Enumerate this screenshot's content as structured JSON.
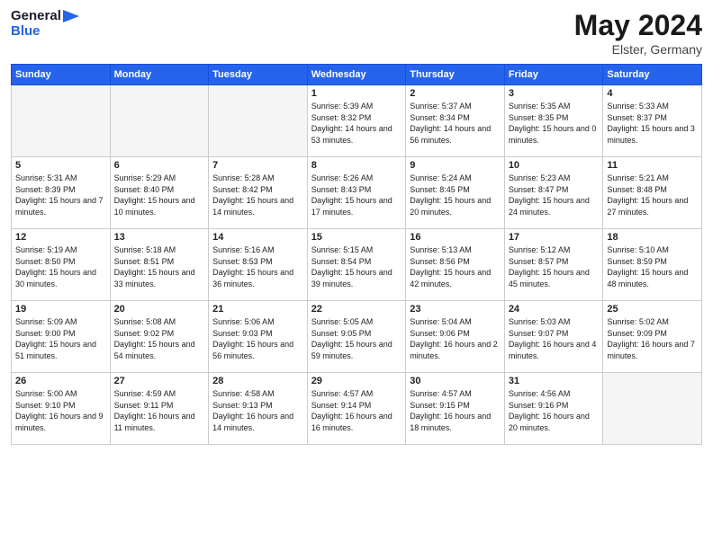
{
  "header": {
    "logo_line1": "General",
    "logo_line2": "Blue",
    "month": "May 2024",
    "location": "Elster, Germany"
  },
  "weekdays": [
    "Sunday",
    "Monday",
    "Tuesday",
    "Wednesday",
    "Thursday",
    "Friday",
    "Saturday"
  ],
  "weeks": [
    [
      {
        "day": "",
        "text": "",
        "empty": true
      },
      {
        "day": "",
        "text": "",
        "empty": true
      },
      {
        "day": "",
        "text": "",
        "empty": true
      },
      {
        "day": "1",
        "text": "Sunrise: 5:39 AM\nSunset: 8:32 PM\nDaylight: 14 hours and 53 minutes."
      },
      {
        "day": "2",
        "text": "Sunrise: 5:37 AM\nSunset: 8:34 PM\nDaylight: 14 hours and 56 minutes."
      },
      {
        "day": "3",
        "text": "Sunrise: 5:35 AM\nSunset: 8:35 PM\nDaylight: 15 hours and 0 minutes."
      },
      {
        "day": "4",
        "text": "Sunrise: 5:33 AM\nSunset: 8:37 PM\nDaylight: 15 hours and 3 minutes."
      }
    ],
    [
      {
        "day": "5",
        "text": "Sunrise: 5:31 AM\nSunset: 8:39 PM\nDaylight: 15 hours and 7 minutes."
      },
      {
        "day": "6",
        "text": "Sunrise: 5:29 AM\nSunset: 8:40 PM\nDaylight: 15 hours and 10 minutes."
      },
      {
        "day": "7",
        "text": "Sunrise: 5:28 AM\nSunset: 8:42 PM\nDaylight: 15 hours and 14 minutes."
      },
      {
        "day": "8",
        "text": "Sunrise: 5:26 AM\nSunset: 8:43 PM\nDaylight: 15 hours and 17 minutes."
      },
      {
        "day": "9",
        "text": "Sunrise: 5:24 AM\nSunset: 8:45 PM\nDaylight: 15 hours and 20 minutes."
      },
      {
        "day": "10",
        "text": "Sunrise: 5:23 AM\nSunset: 8:47 PM\nDaylight: 15 hours and 24 minutes."
      },
      {
        "day": "11",
        "text": "Sunrise: 5:21 AM\nSunset: 8:48 PM\nDaylight: 15 hours and 27 minutes."
      }
    ],
    [
      {
        "day": "12",
        "text": "Sunrise: 5:19 AM\nSunset: 8:50 PM\nDaylight: 15 hours and 30 minutes."
      },
      {
        "day": "13",
        "text": "Sunrise: 5:18 AM\nSunset: 8:51 PM\nDaylight: 15 hours and 33 minutes."
      },
      {
        "day": "14",
        "text": "Sunrise: 5:16 AM\nSunset: 8:53 PM\nDaylight: 15 hours and 36 minutes."
      },
      {
        "day": "15",
        "text": "Sunrise: 5:15 AM\nSunset: 8:54 PM\nDaylight: 15 hours and 39 minutes."
      },
      {
        "day": "16",
        "text": "Sunrise: 5:13 AM\nSunset: 8:56 PM\nDaylight: 15 hours and 42 minutes."
      },
      {
        "day": "17",
        "text": "Sunrise: 5:12 AM\nSunset: 8:57 PM\nDaylight: 15 hours and 45 minutes."
      },
      {
        "day": "18",
        "text": "Sunrise: 5:10 AM\nSunset: 8:59 PM\nDaylight: 15 hours and 48 minutes."
      }
    ],
    [
      {
        "day": "19",
        "text": "Sunrise: 5:09 AM\nSunset: 9:00 PM\nDaylight: 15 hours and 51 minutes."
      },
      {
        "day": "20",
        "text": "Sunrise: 5:08 AM\nSunset: 9:02 PM\nDaylight: 15 hours and 54 minutes."
      },
      {
        "day": "21",
        "text": "Sunrise: 5:06 AM\nSunset: 9:03 PM\nDaylight: 15 hours and 56 minutes."
      },
      {
        "day": "22",
        "text": "Sunrise: 5:05 AM\nSunset: 9:05 PM\nDaylight: 15 hours and 59 minutes."
      },
      {
        "day": "23",
        "text": "Sunrise: 5:04 AM\nSunset: 9:06 PM\nDaylight: 16 hours and 2 minutes."
      },
      {
        "day": "24",
        "text": "Sunrise: 5:03 AM\nSunset: 9:07 PM\nDaylight: 16 hours and 4 minutes."
      },
      {
        "day": "25",
        "text": "Sunrise: 5:02 AM\nSunset: 9:09 PM\nDaylight: 16 hours and 7 minutes."
      }
    ],
    [
      {
        "day": "26",
        "text": "Sunrise: 5:00 AM\nSunset: 9:10 PM\nDaylight: 16 hours and 9 minutes."
      },
      {
        "day": "27",
        "text": "Sunrise: 4:59 AM\nSunset: 9:11 PM\nDaylight: 16 hours and 11 minutes."
      },
      {
        "day": "28",
        "text": "Sunrise: 4:58 AM\nSunset: 9:13 PM\nDaylight: 16 hours and 14 minutes."
      },
      {
        "day": "29",
        "text": "Sunrise: 4:57 AM\nSunset: 9:14 PM\nDaylight: 16 hours and 16 minutes."
      },
      {
        "day": "30",
        "text": "Sunrise: 4:57 AM\nSunset: 9:15 PM\nDaylight: 16 hours and 18 minutes."
      },
      {
        "day": "31",
        "text": "Sunrise: 4:56 AM\nSunset: 9:16 PM\nDaylight: 16 hours and 20 minutes."
      },
      {
        "day": "",
        "text": "",
        "empty": true
      }
    ]
  ]
}
